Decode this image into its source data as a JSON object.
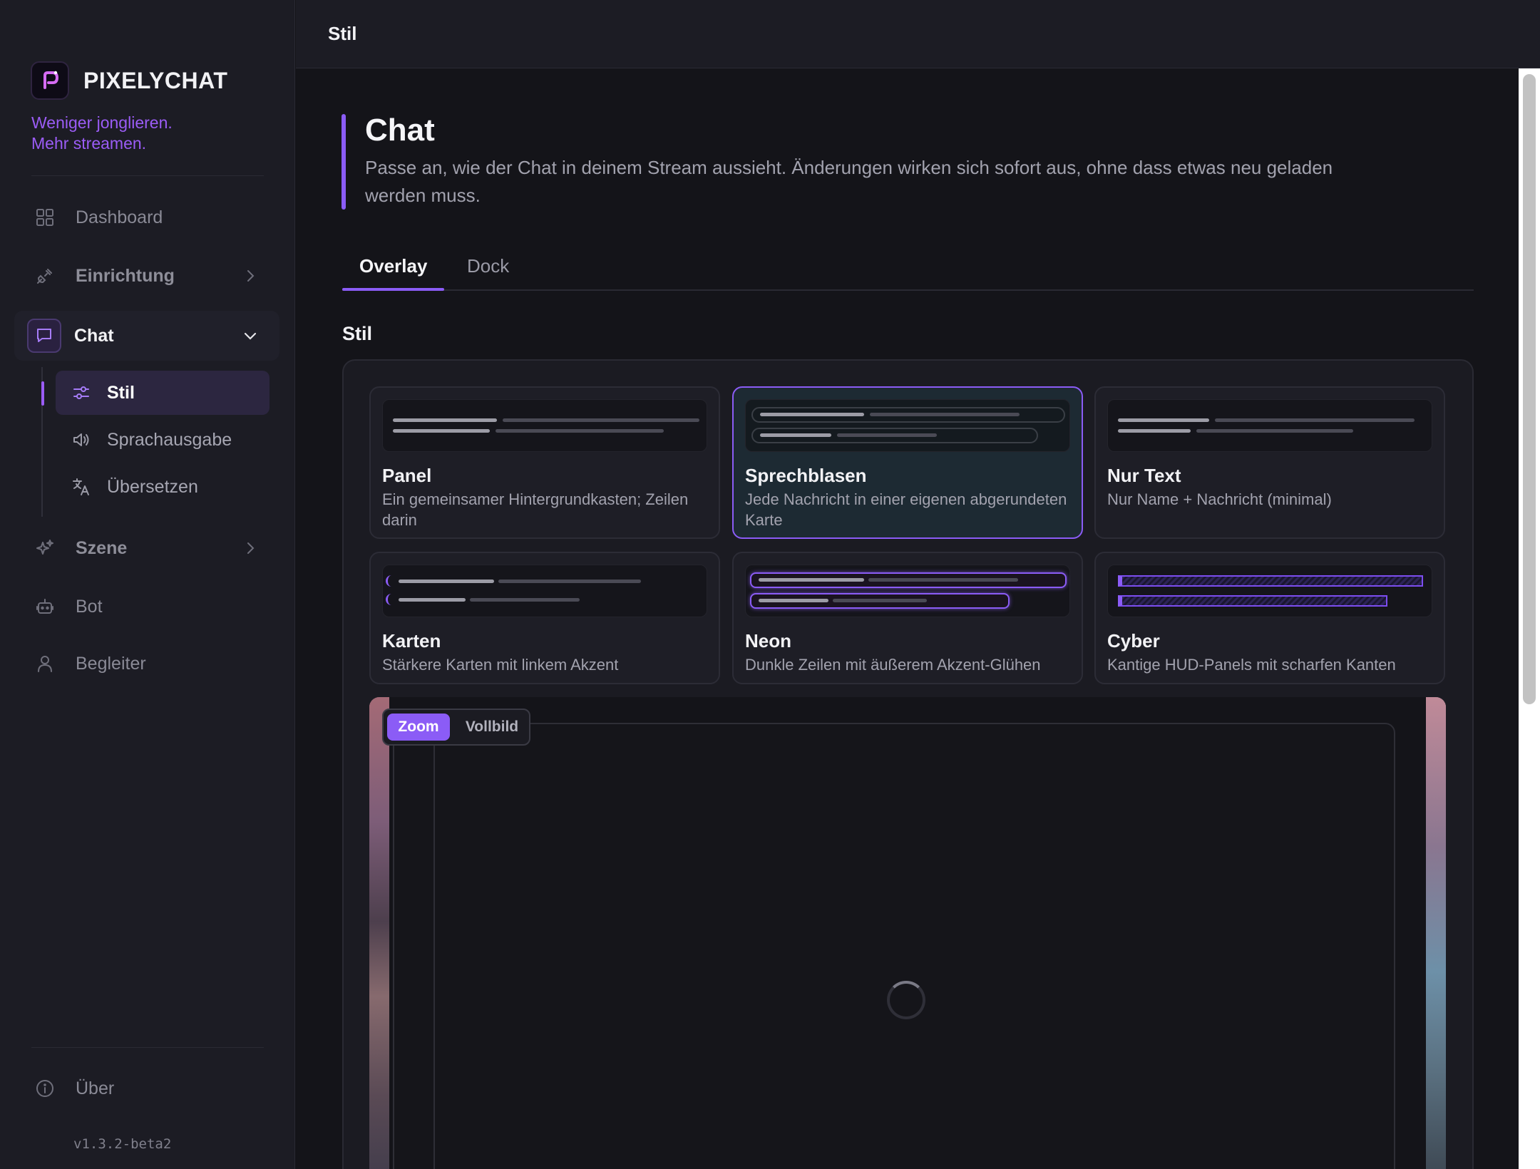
{
  "app": {
    "name": "PIXELYCHAT",
    "tagline_line1": "Weniger jonglieren.",
    "tagline_line2": "Mehr streamen.",
    "version": "v1.3.2-beta2"
  },
  "sidebar": {
    "items": [
      {
        "label": "Dashboard",
        "icon": "grid-icon"
      },
      {
        "label": "Einrichtung",
        "icon": "plug-icon",
        "expandable": true
      },
      {
        "label": "Chat",
        "icon": "chat-bubble-icon",
        "expanded": true
      },
      {
        "label": "Szene",
        "icon": "sparkles-icon",
        "expandable": true
      },
      {
        "label": "Bot",
        "icon": "robot-icon"
      },
      {
        "label": "Begleiter",
        "icon": "user-icon"
      }
    ],
    "chat_sub_items": [
      {
        "label": "Stil",
        "icon": "sliders-icon",
        "active": true
      },
      {
        "label": "Sprachausgabe",
        "icon": "speaker-icon"
      },
      {
        "label": "Übersetzen",
        "icon": "translate-icon"
      }
    ],
    "footer_item": {
      "label": "Über",
      "icon": "info-icon"
    }
  },
  "topbar": {
    "title": "Stil"
  },
  "page": {
    "title": "Chat",
    "description": "Passe an, wie der Chat in deinem Stream aussieht. Änderungen wirken sich sofort aus, ohne dass etwas neu geladen werden muss."
  },
  "tabs": [
    {
      "label": "Overlay",
      "active": true
    },
    {
      "label": "Dock",
      "active": false
    }
  ],
  "section": {
    "title": "Stil"
  },
  "styles": [
    {
      "name": "Panel",
      "desc": "Ein gemeinsamer Hintergrundkasten; Zeilen darin",
      "selected": false
    },
    {
      "name": "Sprechblasen",
      "desc": "Jede Nachricht in einer eigenen abgerundeten Karte",
      "selected": true
    },
    {
      "name": "Nur Text",
      "desc": "Nur Name + Nachricht (minimal)",
      "selected": false
    },
    {
      "name": "Karten",
      "desc": "Stärkere Karten mit linkem Akzent",
      "selected": false
    },
    {
      "name": "Neon",
      "desc": "Dunkle Zeilen mit äußerem Akzent-Glühen",
      "selected": false
    },
    {
      "name": "Cyber",
      "desc": "Kantige HUD-Panels mit scharfen Kanten",
      "selected": false
    }
  ],
  "preview": {
    "zoom_label": "Zoom",
    "fullscreen_label": "Vollbild",
    "active_mode": "Zoom",
    "loading": true
  },
  "colors": {
    "accent": "#8b5cf6",
    "background": "#141419",
    "sidebar": "#1c1c24",
    "selected_card": "#1d2a33"
  }
}
